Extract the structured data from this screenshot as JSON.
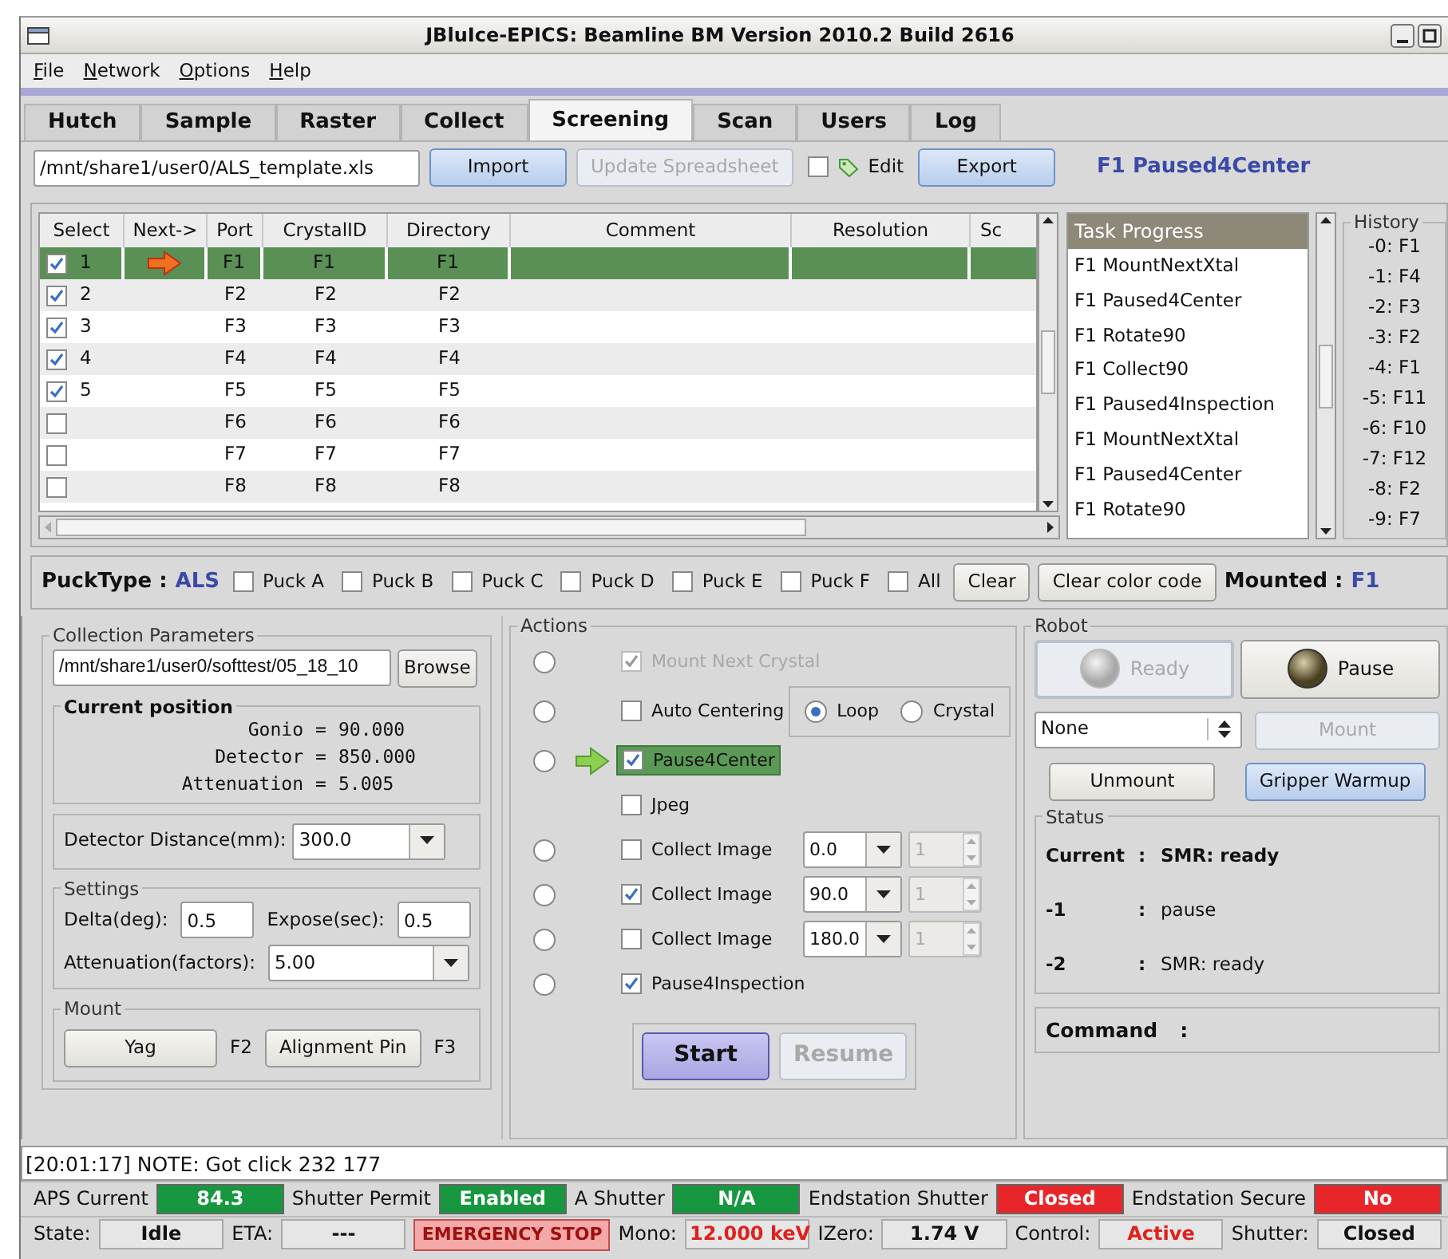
{
  "window": {
    "title": "JBluIce-EPICS: Beamline BM Version 2010.2 Build 2616"
  },
  "menu": [
    {
      "label": "File"
    },
    {
      "label": "Network"
    },
    {
      "label": "Options"
    },
    {
      "label": "Help"
    }
  ],
  "tabs": [
    {
      "label": "Hutch",
      "selected": false
    },
    {
      "label": "Sample",
      "selected": false
    },
    {
      "label": "Raster",
      "selected": false
    },
    {
      "label": "Collect",
      "selected": false
    },
    {
      "label": "Screening",
      "selected": true
    },
    {
      "label": "Scan",
      "selected": false
    },
    {
      "label": "Users",
      "selected": false
    },
    {
      "label": "Log",
      "selected": false
    }
  ],
  "toolbar": {
    "file_path": "/mnt/share1/user0/ALS_template.xls",
    "items": [
      {
        "kind": "button",
        "label": "Import",
        "disabled": false
      },
      {
        "kind": "button",
        "label": "Update Spreadsheet",
        "disabled": true
      },
      {
        "kind": "checkbox",
        "label": "Edit",
        "checked": false
      },
      {
        "kind": "button",
        "label": "Export",
        "disabled": false
      }
    ],
    "status": "F1 Paused4Center"
  },
  "table": {
    "columns": [
      "Select",
      "Next->",
      "Port",
      "CrystalID",
      "Directory",
      "Comment",
      "Resolution",
      "Sc"
    ],
    "rows": [
      {
        "checked": true,
        "select": "1",
        "next": true,
        "port": "F1",
        "crystal_id": "F1",
        "directory": "F1",
        "selected": true
      },
      {
        "checked": true,
        "select": "2",
        "next": false,
        "port": "F2",
        "crystal_id": "F2",
        "directory": "F2",
        "selected": false
      },
      {
        "checked": true,
        "select": "3",
        "next": false,
        "port": "F3",
        "crystal_id": "F3",
        "directory": "F3",
        "selected": false
      },
      {
        "checked": true,
        "select": "4",
        "next": false,
        "port": "F4",
        "crystal_id": "F4",
        "directory": "F4",
        "selected": false
      },
      {
        "checked": true,
        "select": "5",
        "next": false,
        "port": "F5",
        "crystal_id": "F5",
        "directory": "F5",
        "selected": false
      },
      {
        "checked": false,
        "next": false,
        "port": "F6",
        "crystal_id": "F6",
        "directory": "F6",
        "selected": false
      },
      {
        "checked": false,
        "next": false,
        "port": "F7",
        "crystal_id": "F7",
        "directory": "F7",
        "selected": false
      },
      {
        "checked": false,
        "next": false,
        "port": "F8",
        "crystal_id": "F8",
        "directory": "F8",
        "selected": false
      }
    ]
  },
  "task_progress": {
    "title": "Task Progress",
    "items": [
      "F1 MountNextXtal",
      "F1 Paused4Center",
      "F1 Rotate90",
      "F1 Collect90",
      "F1 Paused4Inspection",
      "F1 MountNextXtal",
      "F1 Paused4Center",
      "F1 Rotate90"
    ]
  },
  "history": {
    "title": "History",
    "items": [
      "-0: F1",
      "-1: F4",
      "-2: F3",
      "-3: F2",
      "-4: F1",
      "-5: F11",
      "-6: F10",
      "-7: F12",
      "-8: F2",
      "-9: F7"
    ]
  },
  "puck": {
    "label": "PuckType :",
    "type": "ALS",
    "options": [
      {
        "label": "Puck A",
        "checked": false
      },
      {
        "label": "Puck B",
        "checked": false
      },
      {
        "label": "Puck C",
        "checked": false
      },
      {
        "label": "Puck D",
        "checked": false
      },
      {
        "label": "Puck E",
        "checked": false
      },
      {
        "label": "Puck F",
        "checked": false
      },
      {
        "label": "All",
        "checked": false
      }
    ],
    "buttons": [
      "Clear",
      "Clear color code"
    ],
    "mounted_label": "Mounted :",
    "mounted": "F1"
  },
  "collection": {
    "title": "Collection Parameters",
    "path": "/mnt/share1/user0/softtest/05_18_10",
    "browse": "Browse",
    "position_title": "Current position",
    "position": [
      {
        "name": "Gonio",
        "sep": "=",
        "value": "90.000"
      },
      {
        "name": "Detector",
        "sep": "=",
        "value": "850.000"
      },
      {
        "name": "Attenuation",
        "sep": "=",
        "value": "5.005"
      }
    ],
    "detector_label": "Detector Distance(mm):",
    "detector_value": "300.0",
    "settings_title": "Settings",
    "delta_label": "Delta(deg):",
    "delta": "0.5",
    "expose_label": "Expose(sec):",
    "expose": "0.5",
    "attenuation_label": "Attenuation(factors):",
    "attenuation": "5.00",
    "mount_title": "Mount",
    "mount": [
      {
        "button": "Yag",
        "port": "F2"
      },
      {
        "button": "Alignment Pin",
        "port": "F3"
      }
    ]
  },
  "actions": {
    "title": "Actions",
    "items": [
      {
        "kind": "step",
        "label": "Mount Next Crystal",
        "checked": true,
        "disabled": true,
        "selected": false,
        "current": false
      },
      {
        "kind": "step",
        "label": "Auto Centering",
        "checked": false,
        "disabled": false,
        "selected": false,
        "current": false,
        "modes": [
          {
            "label": "Loop",
            "selected": true
          },
          {
            "label": "Crystal",
            "selected": false
          }
        ]
      },
      {
        "kind": "step",
        "label": "Pause4Center",
        "checked": true,
        "disabled": false,
        "selected": false,
        "current": true
      },
      {
        "kind": "option",
        "label": "Jpeg",
        "checked": false,
        "disabled": false,
        "current": false
      },
      {
        "kind": "collect",
        "label": "Collect Image",
        "checked": false,
        "disabled": false,
        "selected": false,
        "current": false,
        "angle": "0.0",
        "count": "1",
        "count_disabled": true
      },
      {
        "kind": "collect",
        "label": "Collect Image",
        "checked": true,
        "disabled": false,
        "selected": false,
        "current": false,
        "angle": "90.0",
        "count": "1",
        "count_disabled": true
      },
      {
        "kind": "collect",
        "label": "Collect Image",
        "checked": false,
        "disabled": false,
        "selected": false,
        "current": false,
        "angle": "180.0",
        "count": "1",
        "count_disabled": true
      },
      {
        "kind": "step",
        "label": "Pause4Inspection",
        "checked": true,
        "disabled": false,
        "selected": false,
        "current": false
      }
    ],
    "buttons": [
      {
        "label": "Start",
        "disabled": false
      },
      {
        "label": "Resume",
        "disabled": true
      }
    ]
  },
  "robot": {
    "title": "Robot",
    "lamps": [
      {
        "label": "Ready",
        "lit": false,
        "disabled": true,
        "active": true
      },
      {
        "label": "Pause",
        "lit": true,
        "disabled": false,
        "active": false
      }
    ],
    "port_select": "None",
    "mount": {
      "label": "Mount",
      "disabled": true
    },
    "buttons": [
      {
        "label": "Unmount",
        "highlighted": false
      },
      {
        "label": "Gripper Warmup",
        "highlighted": true
      }
    ],
    "status": {
      "title": "Status",
      "rows": [
        {
          "key": "Current",
          "sep": ":",
          "value": "SMR: ready",
          "bold": true
        },
        {
          "key": "-1",
          "sep": ":",
          "value": "pause",
          "bold": false
        },
        {
          "key": "-2",
          "sep": ":",
          "value": "SMR: ready",
          "bold": false
        }
      ]
    },
    "command": {
      "label": "Command",
      "sep": ":"
    }
  },
  "status_bar": {
    "log": "[20:01:17] NOTE: Got click 232 177",
    "indicators": [
      {
        "kind": "lamp",
        "label": "APS Current",
        "value": "84.3",
        "color": "#17973f"
      },
      {
        "kind": "lamp",
        "label": "Shutter Permit",
        "value": "Enabled",
        "color": "#17973f"
      },
      {
        "kind": "lamp",
        "label": "A Shutter",
        "value": "N/A",
        "color": "#17973f"
      },
      {
        "kind": "lamp",
        "label": "Endstation Shutter",
        "value": "Closed",
        "color": "#e8262a"
      },
      {
        "kind": "lamp",
        "label": "Endstation Secure",
        "value": "No",
        "color": "#e8262a"
      }
    ],
    "readouts": [
      {
        "kind": "field",
        "label": "State:",
        "value": "Idle",
        "color": "#111111"
      },
      {
        "kind": "field",
        "label": "ETA:",
        "value": "---",
        "color": "#111111"
      },
      {
        "kind": "button",
        "label": "EMERGENCY STOP"
      },
      {
        "kind": "field",
        "label": "Mono:",
        "value": "12.000 keV",
        "color": "#e0201c"
      },
      {
        "kind": "field",
        "label": "IZero:",
        "value": "1.74 V",
        "color": "#111111"
      },
      {
        "kind": "field",
        "label": "Control:",
        "value": "Active",
        "color": "#e0201c"
      },
      {
        "kind": "field",
        "label": "Shutter:",
        "value": "Closed",
        "color": "#111111"
      }
    ]
  }
}
